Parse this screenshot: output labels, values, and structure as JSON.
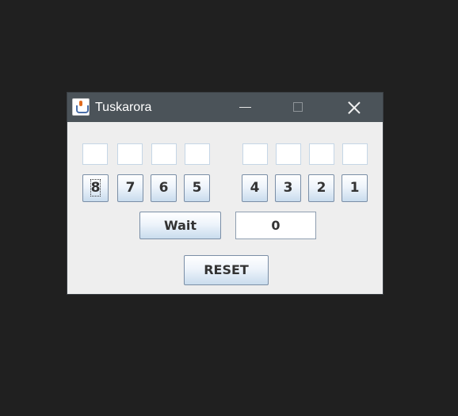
{
  "window": {
    "title": "Tuskarora",
    "icon": "java-cup-icon"
  },
  "title_controls": [
    "minimize-icon",
    "maximize-icon",
    "close-icon"
  ],
  "digit_buttons": [
    "8",
    "7",
    "6",
    "5",
    "4",
    "3",
    "2",
    "1"
  ],
  "wait_button": {
    "label": "Wait"
  },
  "counter": {
    "value": "0"
  },
  "reset_button": {
    "label": "RESET"
  },
  "colors": {
    "desktop": "#202020",
    "titlebar": "#4b5359",
    "panel": "#eeeeee",
    "button_border": "#7a8ea6"
  }
}
